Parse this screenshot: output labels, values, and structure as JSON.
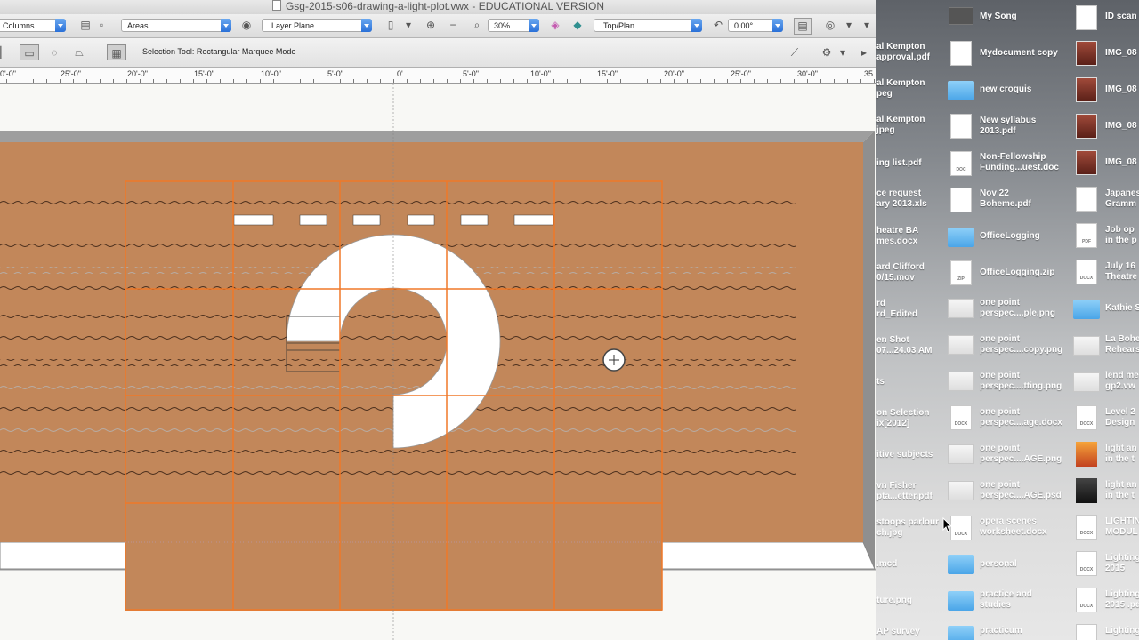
{
  "titlebar": {
    "title": "Gsg-2015-s06-drawing-a-light-plot.vwx - EDUCATIONAL VERSION"
  },
  "viewbar": {
    "class_value": "Columns",
    "layer_value": "Areas",
    "plane_value": "Layer Plane",
    "zoom_value": "30%",
    "view_value": "Top/Plan",
    "rotation_value": "0.00°"
  },
  "modebar": {
    "tool_message": "Selection Tool: Rectangular Marquee Mode"
  },
  "ruler": {
    "labels": [
      "0'-0\"",
      "25'-0\"",
      "20'-0\"",
      "15'-0\"",
      "10'-0\"",
      "5'-0\"",
      "0'",
      "5'-0\"",
      "10'-0\"",
      "15'-0\"",
      "20'-0\"",
      "25'-0\"",
      "30'-0\"",
      "35"
    ]
  },
  "colors": {
    "stage": "#c2875a",
    "grid": "#f07828",
    "border": "#808080"
  },
  "desktop": {
    "left_labels": [
      "al Kempton",
      "approval.pdf",
      "al Kempton",
      "peg",
      "al Kempton",
      "jpeg",
      "ing list.pdf",
      "ce request",
      "ary 2013.xls",
      "heatre BA",
      "mes.docx",
      "ard Clifford",
      "0/15.mov",
      "rd",
      "rd_Edited",
      "en Shot",
      "07...24.03 AM",
      "ts",
      "on Selection",
      "ix[2012]",
      "itive subjects",
      "vn Fisher",
      "pta...etter.pdf",
      "stoops parlour",
      "ch.jpg",
      ".mcd",
      "ture.png",
      "AP survey"
    ],
    "middle_labels": [
      "My Song",
      "Mydocument copy",
      "new croquis",
      "New syllabus",
      "2013.pdf",
      "Non-Fellowship",
      "Funding...uest.doc",
      "Nov 22",
      "Boheme.pdf",
      "OfficeLogging",
      "OfficeLogging.zip",
      "one point",
      "perspec....ple.png",
      "one point",
      "perspec....copy.png",
      "one point",
      "perspec....tting.png",
      "one point",
      "perspec....age.docx",
      "one point",
      "perspec....AGE.png",
      "one point",
      "perspec....AGE.psd",
      "opera scenes",
      "worksheet.docx",
      "personal",
      "practice and",
      "studies",
      "practicum"
    ],
    "right_labels": [
      "ID scan",
      "IMG_08",
      "IMG_08",
      "IMG_08",
      "IMG_08",
      "Japanes",
      "Gramm",
      "Job op",
      "in the p",
      "July 16",
      "Theatre",
      "Kathie S",
      "La Bohe",
      "Rehears",
      "lend me",
      "gp2.vw",
      "Level 2",
      "Design",
      "light an",
      "in the t",
      "light an",
      "in the t",
      "LIGHTIN",
      "MODUL",
      "Lighting",
      "2015",
      "Lighting",
      "2015 .pd",
      "Lighting"
    ],
    "icon_badges": [
      "DOC",
      "ZIP",
      "DOCX",
      "DOCX",
      "PDF",
      "DOCX",
      "DOCX",
      "DOCX",
      "DOCX",
      "DOCX"
    ]
  }
}
